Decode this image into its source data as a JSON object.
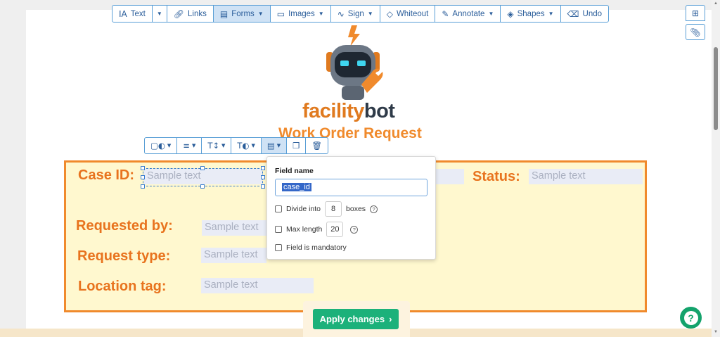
{
  "toolbar": {
    "text": "Text",
    "links": "Links",
    "forms": "Forms",
    "images": "Images",
    "sign": "Sign",
    "whiteout": "Whiteout",
    "annotate": "Annotate",
    "shapes": "Shapes",
    "undo": "Undo"
  },
  "brand": {
    "facility": "facility",
    "bot": "bot"
  },
  "title": "Work Order Request",
  "form": {
    "case_id_label": "Case ID:",
    "status_label": "Status:",
    "requested_by_label": "Requested by:",
    "request_type_label": "Request type:",
    "location_tag_label": "Location tag:",
    "placeholder": "Sample text"
  },
  "popup": {
    "field_name_label": "Field name",
    "field_name_value": "case_id",
    "divide_into_label": "Divide into",
    "divide_into_value": "8",
    "boxes_label": "boxes",
    "max_length_label": "Max length",
    "max_length_value": "20",
    "mandatory_label": "Field is mandatory"
  },
  "apply_label": "Apply changes",
  "colors": {
    "accent": "#f08a2c",
    "toolbar": "#2a5d9a",
    "apply": "#1cb17a",
    "form_bg": "#fff8cf"
  }
}
